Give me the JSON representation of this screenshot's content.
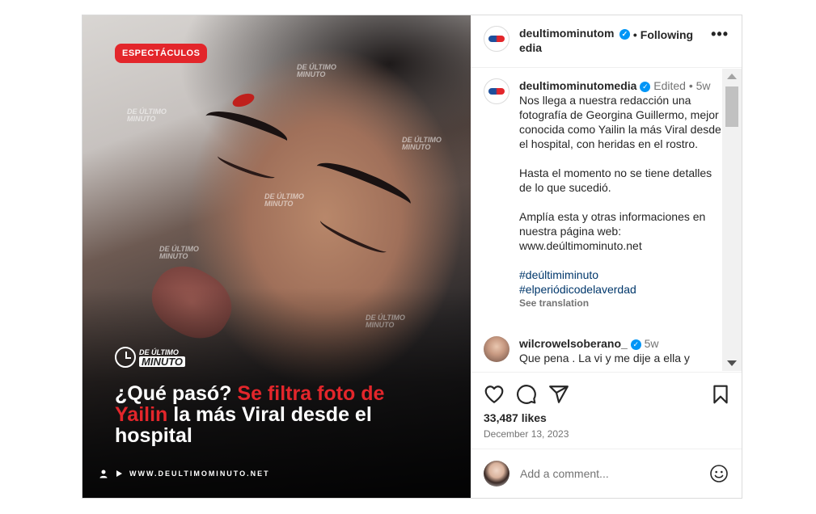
{
  "media": {
    "badge": "ESPECTÁCULOS",
    "watermark_line1": "DE ÚLTIMO",
    "watermark_line2": "MINUTO",
    "logo_line1": "DE ÚLTIMO",
    "logo_line2": "MINUTO",
    "headline_part1": "¿Qué pasó? ",
    "headline_red": "Se filtra foto de Yailin",
    "headline_part2": " la más Viral desde el hospital",
    "footer_url": "WWW.DEULTIMOMINUTO.NET"
  },
  "header": {
    "username": "deultimominutomedia",
    "separator": "•",
    "follow_label": "Following",
    "more_icon": "more-horizontal-icon"
  },
  "caption": {
    "username": "deultimominutomedia",
    "edited": "Edited",
    "dot": "•",
    "time": "5w",
    "para1": "Nos llega a nuestra redacción una fotografía de Georgina Guillermo, mejor conocida como Yailin la más Viral desde el hospital, con heridas en el rostro.",
    "para2": "Hasta el momento no se tiene detalles de lo que sucedió.",
    "para3": "Amplía esta y otras informaciones en nuestra página web: www.deúltimominuto.net",
    "hashtag1": "#deúltimiminuto",
    "hashtag2": "#elperiódicodelaverdad",
    "see_translation": "See translation"
  },
  "comment": {
    "username": "wilcrowelsoberano_",
    "time": "5w",
    "text": "Que pena . La vi y me dije a ella y"
  },
  "actions": {
    "icons": [
      "heart-icon",
      "comment-icon",
      "share-icon",
      "bookmark-icon"
    ],
    "likes": "33,487 likes",
    "date": "December 13, 2023"
  },
  "add_comment": {
    "placeholder": "Add a comment...",
    "emoji_icon": "emoji-icon"
  },
  "colors": {
    "accent_red": "#e3262b",
    "verified_blue": "#0095f6",
    "link_dark_blue": "#00376b",
    "text_primary": "#262626",
    "text_secondary": "#737373"
  }
}
